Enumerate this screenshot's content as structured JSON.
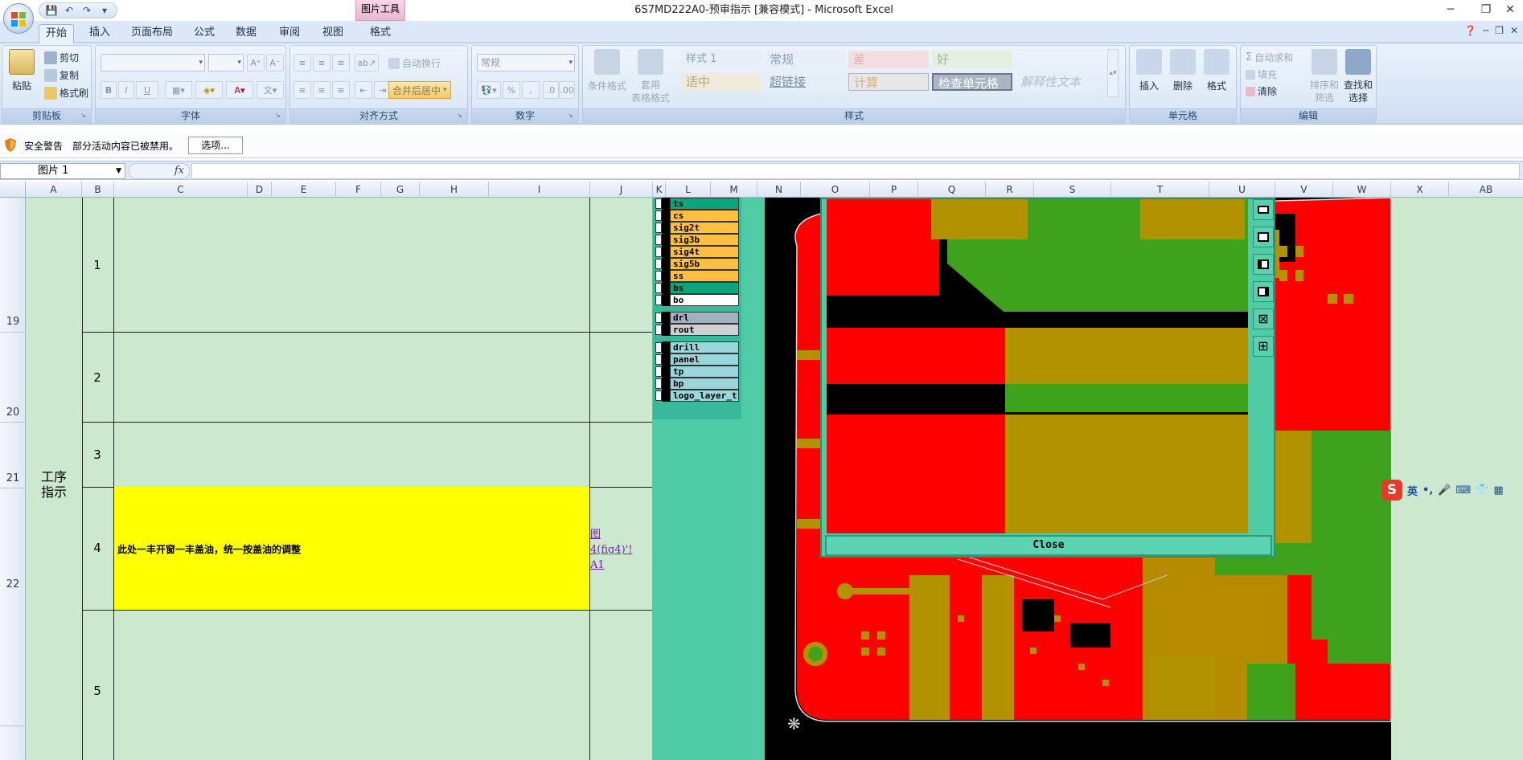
{
  "window": {
    "title": "6S7MD222A0-预审指示  [兼容模式] - Microsoft Excel",
    "context_tab": "图片工具",
    "controls": [
      "─",
      "❐",
      "✕"
    ]
  },
  "qat": {
    "save": "💾",
    "undo": "↶",
    "redo": "↷",
    "customize": "▾"
  },
  "tabs": [
    "开始",
    "插入",
    "页面布局",
    "公式",
    "数据",
    "审阅",
    "视图",
    "格式"
  ],
  "ribbon": {
    "clipboard": {
      "label": "剪贴板",
      "paste": "粘贴",
      "cut": "剪切",
      "copy": "复制",
      "painter": "格式刷"
    },
    "font": {
      "label": "字体",
      "bold": "B",
      "italic": "I",
      "underline": "U"
    },
    "alignment": {
      "label": "对齐方式",
      "wrap": "自动换行",
      "merge": "合并后居中"
    },
    "number": {
      "label": "数字",
      "format": "常规"
    },
    "styles": {
      "label": "样式",
      "conditional": "条件格式",
      "table": "套用\n表格格式",
      "cells": [
        "样式 1",
        "常规",
        "差",
        "好",
        "适中",
        "超链接",
        "计算",
        "检查单元格",
        "解释性文本"
      ]
    },
    "cells": {
      "label": "单元格",
      "insert": "插入",
      "delete": "删除",
      "format": "格式"
    },
    "editing": {
      "label": "编辑",
      "autosum": "自动求和",
      "fill": "填充",
      "clear": "清除",
      "sort": "排序和\n筛选",
      "find": "查找和\n选择"
    }
  },
  "security": {
    "title": "安全警告",
    "message": "部分活动内容已被禁用。",
    "options": "选项..."
  },
  "formula_bar": {
    "name_box": "图片 1",
    "fx": "fx",
    "content": ""
  },
  "columns": [
    "A",
    "B",
    "C",
    "D",
    "E",
    "F",
    "G",
    "H",
    "I",
    "J",
    "K",
    "L",
    "M",
    "N",
    "O",
    "P",
    "Q",
    "R",
    "S",
    "T",
    "U",
    "V",
    "W",
    "X",
    "AB"
  ],
  "rows": [
    "19",
    "20",
    "21",
    "22"
  ],
  "sheet": {
    "process_label": "工序\n指示",
    "step_numbers": [
      "1",
      "2",
      "3",
      "4",
      "5"
    ],
    "instruction": "此处一丰开窗一丰盖油，统一按盖油的调整",
    "link": "图\n4(fig4)'!\nA1"
  },
  "cam": {
    "layers": [
      {
        "name": "ts",
        "color": "#0aa57a"
      },
      {
        "name": "cs",
        "color": "#ffbf40"
      },
      {
        "name": "sig2t",
        "color": "#ffbf40"
      },
      {
        "name": "sig3b",
        "color": "#ffbf40"
      },
      {
        "name": "sig4t",
        "color": "#ffbf40"
      },
      {
        "name": "sig5b",
        "color": "#ffbf40"
      },
      {
        "name": "ss",
        "color": "#ffbf40"
      },
      {
        "name": "bs",
        "color": "#0aa57a"
      },
      {
        "name": "bo",
        "color": "#ffffff"
      },
      {
        "name": "drl",
        "color": "#9fb3c0"
      },
      {
        "name": "rout",
        "color": "#d0d0d0"
      },
      {
        "name": "drill",
        "color": "#9ad7dd"
      },
      {
        "name": "panel",
        "color": "#9ad7dd"
      },
      {
        "name": "tp",
        "color": "#9ad7dd"
      },
      {
        "name": "bp",
        "color": "#9ad7dd"
      },
      {
        "name": "logo_layer_t",
        "color": "#9ad7dd"
      }
    ],
    "close": "Close",
    "colors": {
      "red": "#ff0000",
      "olive": "#b39200",
      "green": "#3fa21c",
      "teal": "#4fcba5"
    }
  },
  "ime": {
    "logo": "S",
    "lang": "英",
    "items": [
      "•,",
      "🎤",
      "⌨",
      "👕",
      "▦"
    ]
  }
}
